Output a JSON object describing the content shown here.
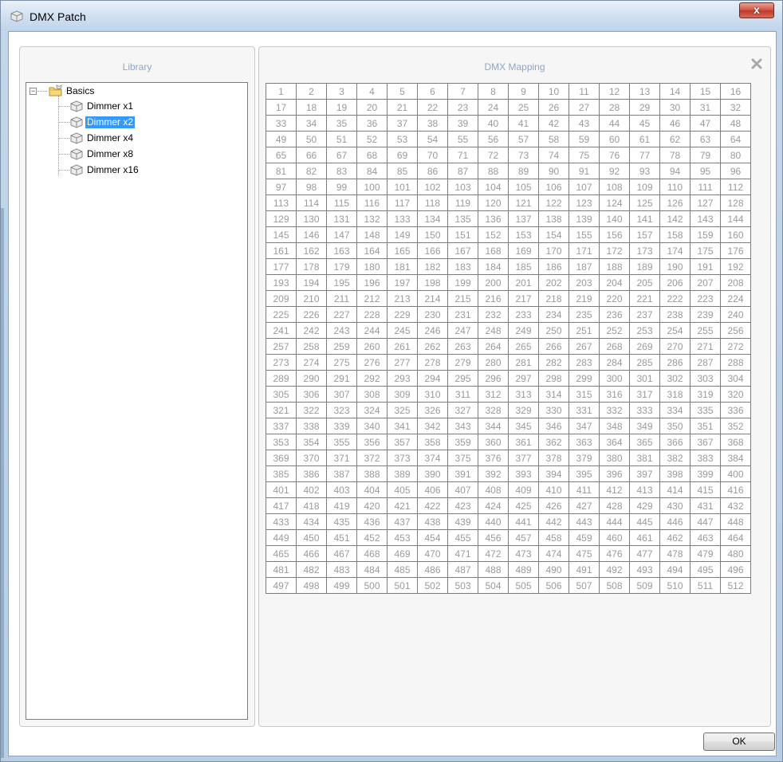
{
  "window": {
    "title": "DMX Patch",
    "close_label": "x",
    "app_icon": "box-icon"
  },
  "library": {
    "header": "Library",
    "tree": {
      "root": {
        "label": "Basics",
        "icon": "folder-icon",
        "expander": "−",
        "expanded": true
      },
      "items": [
        {
          "label": "Dimmer x1",
          "icon": "dimmer-box-icon",
          "selected": false
        },
        {
          "label": "Dimmer x2",
          "icon": "dimmer-box-icon",
          "selected": true
        },
        {
          "label": "Dimmer x4",
          "icon": "dimmer-box-icon",
          "selected": false
        },
        {
          "label": "Dimmer x8",
          "icon": "dimmer-box-icon",
          "selected": false
        },
        {
          "label": "Dimmer x16",
          "icon": "dimmer-box-icon",
          "selected": false
        }
      ]
    }
  },
  "mapping": {
    "header": "DMX Mapping",
    "close_icon": "close-icon",
    "columns": 16,
    "channel_start": 1,
    "channel_end": 512
  },
  "footer": {
    "ok_label": "OK"
  },
  "colors": {
    "selection": "#3399ff",
    "header_text": "#8ea7c2",
    "cell_text": "#9a9a9a"
  }
}
